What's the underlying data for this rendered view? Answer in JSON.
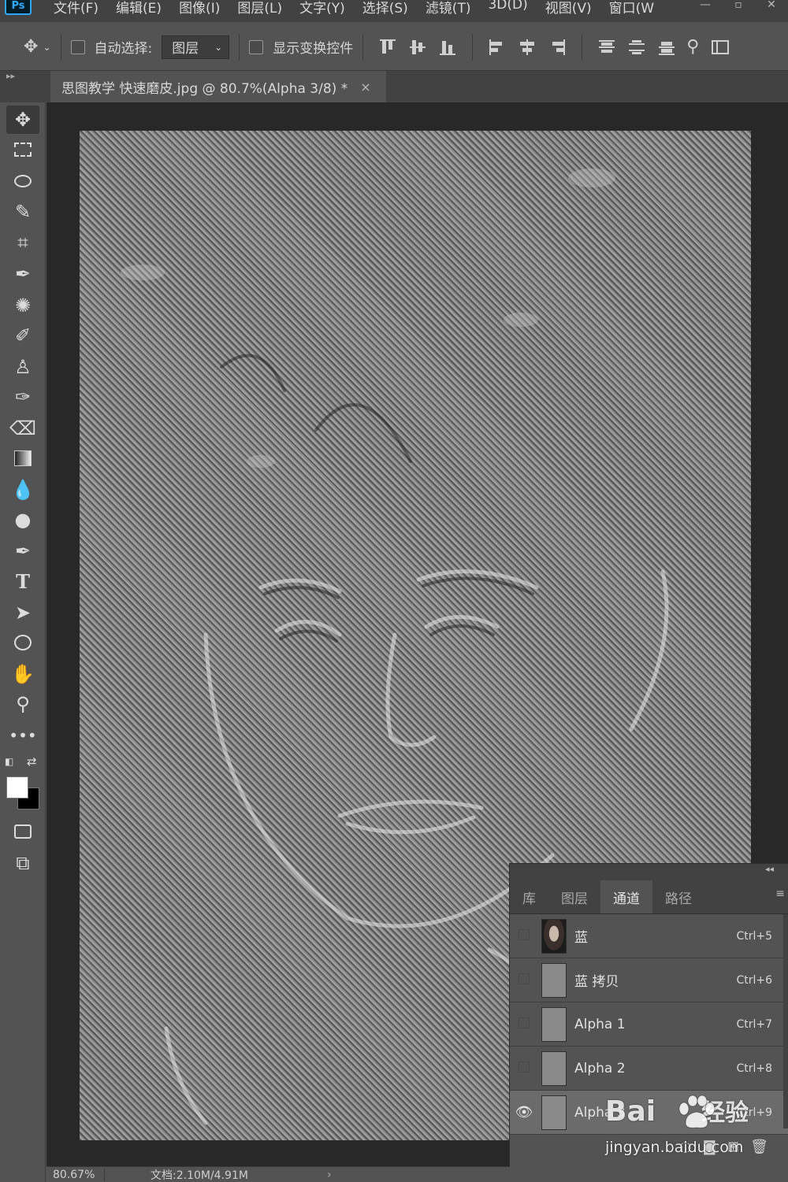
{
  "app": {
    "logo": "Ps"
  },
  "menu": [
    {
      "label": "文件(F)"
    },
    {
      "label": "编辑(E)"
    },
    {
      "label": "图像(I)"
    },
    {
      "label": "图层(L)"
    },
    {
      "label": "文字(Y)"
    },
    {
      "label": "选择(S)"
    },
    {
      "label": "滤镜(T)"
    },
    {
      "label": "3D(D)"
    },
    {
      "label": "视图(V)"
    },
    {
      "label": "窗口(W"
    }
  ],
  "options_bar": {
    "auto_select_label": "自动选择:",
    "auto_select_value": "图层",
    "show_transform_label": "显示变换控件"
  },
  "document": {
    "tab_title": "思图教学 快速磨皮.jpg @ 80.7%(Alpha 3/8) *",
    "close_glyph": "×"
  },
  "status": {
    "zoom": "80.67%",
    "doc_size": "文档:2.10M/4.91M",
    "arrow": "›"
  },
  "channels_panel": {
    "tabs": [
      {
        "label": "库",
        "active": false
      },
      {
        "label": "图层",
        "active": false
      },
      {
        "label": "通道",
        "active": true
      },
      {
        "label": "路径",
        "active": false
      }
    ],
    "channels": [
      {
        "name": "蓝",
        "shortcut": "Ctrl+5",
        "visible": false,
        "selected": false
      },
      {
        "name": "蓝 拷贝",
        "shortcut": "Ctrl+6",
        "visible": false,
        "selected": false
      },
      {
        "name": "Alpha 1",
        "shortcut": "Ctrl+7",
        "visible": false,
        "selected": false
      },
      {
        "name": "Alpha 2",
        "shortcut": "Ctrl+8",
        "visible": false,
        "selected": false
      },
      {
        "name": "Alpha 3",
        "shortcut": "Ctrl+9",
        "visible": true,
        "selected": true
      }
    ]
  },
  "colors": {
    "foreground": "#ffffff",
    "background": "#000000",
    "accent": "#31a8ff"
  },
  "watermark": {
    "logo_text": "Bai",
    "logo_cn": "经验",
    "url": "jingyan.baidu.com"
  }
}
